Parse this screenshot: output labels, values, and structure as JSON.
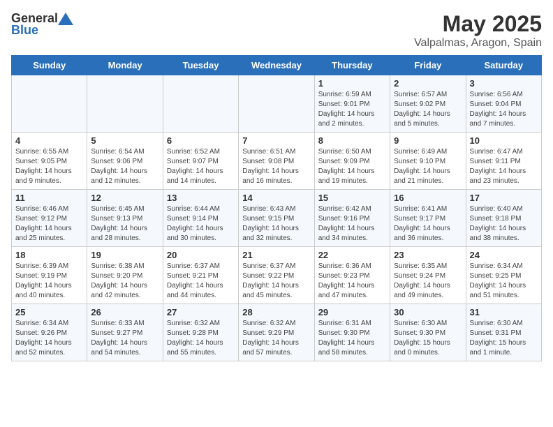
{
  "header": {
    "logo_general": "General",
    "logo_blue": "Blue",
    "title": "May 2025",
    "subtitle": "Valpalmas, Aragon, Spain"
  },
  "days_of_week": [
    "Sunday",
    "Monday",
    "Tuesday",
    "Wednesday",
    "Thursday",
    "Friday",
    "Saturday"
  ],
  "weeks": [
    [
      {
        "day": "",
        "info": ""
      },
      {
        "day": "",
        "info": ""
      },
      {
        "day": "",
        "info": ""
      },
      {
        "day": "",
        "info": ""
      },
      {
        "day": "1",
        "info": "Sunrise: 6:59 AM\nSunset: 9:01 PM\nDaylight: 14 hours\nand 2 minutes."
      },
      {
        "day": "2",
        "info": "Sunrise: 6:57 AM\nSunset: 9:02 PM\nDaylight: 14 hours\nand 5 minutes."
      },
      {
        "day": "3",
        "info": "Sunrise: 6:56 AM\nSunset: 9:04 PM\nDaylight: 14 hours\nand 7 minutes."
      }
    ],
    [
      {
        "day": "4",
        "info": "Sunrise: 6:55 AM\nSunset: 9:05 PM\nDaylight: 14 hours\nand 9 minutes."
      },
      {
        "day": "5",
        "info": "Sunrise: 6:54 AM\nSunset: 9:06 PM\nDaylight: 14 hours\nand 12 minutes."
      },
      {
        "day": "6",
        "info": "Sunrise: 6:52 AM\nSunset: 9:07 PM\nDaylight: 14 hours\nand 14 minutes."
      },
      {
        "day": "7",
        "info": "Sunrise: 6:51 AM\nSunset: 9:08 PM\nDaylight: 14 hours\nand 16 minutes."
      },
      {
        "day": "8",
        "info": "Sunrise: 6:50 AM\nSunset: 9:09 PM\nDaylight: 14 hours\nand 19 minutes."
      },
      {
        "day": "9",
        "info": "Sunrise: 6:49 AM\nSunset: 9:10 PM\nDaylight: 14 hours\nand 21 minutes."
      },
      {
        "day": "10",
        "info": "Sunrise: 6:47 AM\nSunset: 9:11 PM\nDaylight: 14 hours\nand 23 minutes."
      }
    ],
    [
      {
        "day": "11",
        "info": "Sunrise: 6:46 AM\nSunset: 9:12 PM\nDaylight: 14 hours\nand 25 minutes."
      },
      {
        "day": "12",
        "info": "Sunrise: 6:45 AM\nSunset: 9:13 PM\nDaylight: 14 hours\nand 28 minutes."
      },
      {
        "day": "13",
        "info": "Sunrise: 6:44 AM\nSunset: 9:14 PM\nDaylight: 14 hours\nand 30 minutes."
      },
      {
        "day": "14",
        "info": "Sunrise: 6:43 AM\nSunset: 9:15 PM\nDaylight: 14 hours\nand 32 minutes."
      },
      {
        "day": "15",
        "info": "Sunrise: 6:42 AM\nSunset: 9:16 PM\nDaylight: 14 hours\nand 34 minutes."
      },
      {
        "day": "16",
        "info": "Sunrise: 6:41 AM\nSunset: 9:17 PM\nDaylight: 14 hours\nand 36 minutes."
      },
      {
        "day": "17",
        "info": "Sunrise: 6:40 AM\nSunset: 9:18 PM\nDaylight: 14 hours\nand 38 minutes."
      }
    ],
    [
      {
        "day": "18",
        "info": "Sunrise: 6:39 AM\nSunset: 9:19 PM\nDaylight: 14 hours\nand 40 minutes."
      },
      {
        "day": "19",
        "info": "Sunrise: 6:38 AM\nSunset: 9:20 PM\nDaylight: 14 hours\nand 42 minutes."
      },
      {
        "day": "20",
        "info": "Sunrise: 6:37 AM\nSunset: 9:21 PM\nDaylight: 14 hours\nand 44 minutes."
      },
      {
        "day": "21",
        "info": "Sunrise: 6:37 AM\nSunset: 9:22 PM\nDaylight: 14 hours\nand 45 minutes."
      },
      {
        "day": "22",
        "info": "Sunrise: 6:36 AM\nSunset: 9:23 PM\nDaylight: 14 hours\nand 47 minutes."
      },
      {
        "day": "23",
        "info": "Sunrise: 6:35 AM\nSunset: 9:24 PM\nDaylight: 14 hours\nand 49 minutes."
      },
      {
        "day": "24",
        "info": "Sunrise: 6:34 AM\nSunset: 9:25 PM\nDaylight: 14 hours\nand 51 minutes."
      }
    ],
    [
      {
        "day": "25",
        "info": "Sunrise: 6:34 AM\nSunset: 9:26 PM\nDaylight: 14 hours\nand 52 minutes."
      },
      {
        "day": "26",
        "info": "Sunrise: 6:33 AM\nSunset: 9:27 PM\nDaylight: 14 hours\nand 54 minutes."
      },
      {
        "day": "27",
        "info": "Sunrise: 6:32 AM\nSunset: 9:28 PM\nDaylight: 14 hours\nand 55 minutes."
      },
      {
        "day": "28",
        "info": "Sunrise: 6:32 AM\nSunset: 9:29 PM\nDaylight: 14 hours\nand 57 minutes."
      },
      {
        "day": "29",
        "info": "Sunrise: 6:31 AM\nSunset: 9:30 PM\nDaylight: 14 hours\nand 58 minutes."
      },
      {
        "day": "30",
        "info": "Sunrise: 6:30 AM\nSunset: 9:30 PM\nDaylight: 15 hours\nand 0 minutes."
      },
      {
        "day": "31",
        "info": "Sunrise: 6:30 AM\nSunset: 9:31 PM\nDaylight: 15 hours\nand 1 minute."
      }
    ]
  ]
}
